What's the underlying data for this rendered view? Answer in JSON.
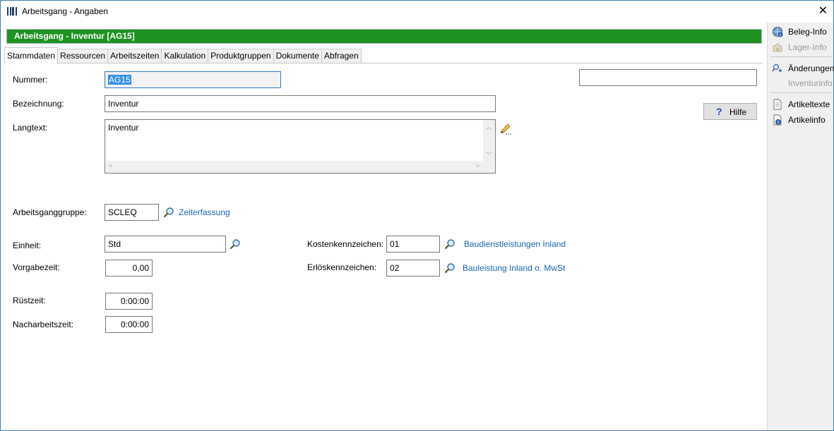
{
  "window": {
    "title": "Arbeitsgang - Angaben",
    "close_glyph": "✕"
  },
  "banner": {
    "text": "Arbeitsgang  -  Inventur [AG15]",
    "color": "#1e9222"
  },
  "tabs": [
    {
      "label": "Stammdaten",
      "active": true
    },
    {
      "label": "Ressourcen"
    },
    {
      "label": "Arbeitszeiten"
    },
    {
      "label": "Kalkulation"
    },
    {
      "label": "Produktgruppen"
    },
    {
      "label": "Dokumente"
    },
    {
      "label": "Abfragen"
    }
  ],
  "form": {
    "nummer": {
      "label": "Nummer:",
      "value": "AG15"
    },
    "bezeichnung": {
      "label": "Bezeichnung:",
      "value": "Inventur"
    },
    "langtext": {
      "label": "Langtext:",
      "value": "Inventur"
    },
    "arbeitsganggruppe": {
      "label": "Arbeitsganggruppe:",
      "value": "SCLEQ",
      "link": "Zeiterfassung"
    },
    "einheit": {
      "label": "Einheit:",
      "value": "Std"
    },
    "vorgabezeit": {
      "label": "Vorgabezeit:",
      "value": "0,00"
    },
    "ruestzeit": {
      "label": "Rüstzeit:",
      "value": "0:00:00"
    },
    "nacharbeitszeit": {
      "label": "Nacharbeitszeit:",
      "value": "0:00:00"
    },
    "kostenkennzeichen": {
      "label": "Kostenkennzeichen:",
      "value": "01",
      "link": "Baudienstleistungen Inland"
    },
    "erloeskennzeichen": {
      "label": "Erlöskennzeichen:",
      "value": "02",
      "link": "Bauleistung Inland o. MwSt"
    },
    "search_box": {
      "value": ""
    }
  },
  "help_button": {
    "label": "Hilfe",
    "icon": "help-icon"
  },
  "sidebar": {
    "items": [
      {
        "label": "Beleg-Info",
        "icon": "globe-info-icon",
        "enabled": true
      },
      {
        "label": "Lager-Info",
        "icon": "warehouse-icon",
        "enabled": false
      },
      {
        "label": "Änderungen",
        "icon": "changes-icon",
        "enabled": true
      },
      {
        "label": "Inventurinfo",
        "icon": "",
        "enabled": false
      },
      {
        "label": "Artikeltexte",
        "icon": "document-icon",
        "enabled": true
      },
      {
        "label": "Artikelinfo",
        "icon": "document-info-icon",
        "enabled": true
      }
    ]
  },
  "colors": {
    "link": "#1a65b6",
    "accent": "#2a78d4"
  }
}
